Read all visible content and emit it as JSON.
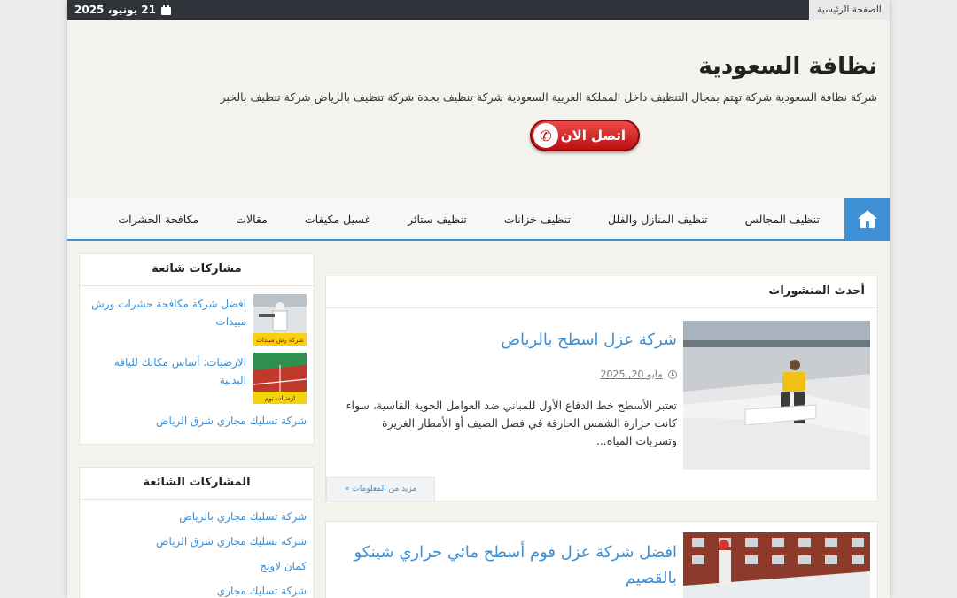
{
  "topbar": {
    "home_label": "الصفحة الرئيسية",
    "date": "21 يونيو، 2025"
  },
  "header": {
    "site_title": "نظافة السعودية",
    "site_description": "شركة نظافة السعودية شركة تهتم بمجال التنظيف داخل المملكة العربية السعودية شركة تنظيف بجدة شركة تنظيف بالرياض شركة تنظيف بالخبر",
    "call_button": "اتصل الان"
  },
  "nav": {
    "items": [
      {
        "label": "تنظيف المجالس"
      },
      {
        "label": "تنظيف المنازل والفلل"
      },
      {
        "label": "تنظيف خزانات"
      },
      {
        "label": "تنظيف ستائر"
      },
      {
        "label": "غسيل مكيفات"
      },
      {
        "label": "مقالات"
      },
      {
        "label": "مكافحة الحشرات"
      }
    ]
  },
  "main": {
    "section_title": "أحدث المنشورات",
    "posts": [
      {
        "title": "شركة عزل اسطح بالرياض",
        "date": "مايو 20, 2025",
        "excerpt": "تعتبر الأسطح خط الدفاع الأول للمباني ضد العوامل الجوية القاسية، سواء كانت حرارة الشمس الحارقة في فصل الصيف أو الأمطار الغزيرة وتسربات المياه...",
        "read_more": "مزيد من المعلومات »"
      },
      {
        "title": "افضل شركة عزل فوم أسطح مائي حراري شينكو بالقصيم"
      }
    ]
  },
  "sidebar": {
    "popular_title": "مشاركات شائعة",
    "popular_posts": [
      {
        "title": "افضل شركة مكافحة حشرات ورش مبيدات",
        "thumb_caption": "شركة رش مبيدات"
      },
      {
        "title": "الارضيات: أساس مكانك للياقة البدنية",
        "thumb_caption": "ارضيات نوم"
      },
      {
        "title": "شركة تسليك مجاري شرق الرياض"
      }
    ],
    "popular2_title": "المشاركات الشائعة",
    "popular2_posts": [
      {
        "title": "شركة تسليك مجاري بالرياض"
      },
      {
        "title": "شركة تسليك مجاري شرق الرياض"
      },
      {
        "title": "كمان لاونج"
      },
      {
        "title": "شركة تسليك مجاري"
      }
    ]
  },
  "colors": {
    "accent": "#3e8fd3",
    "topbar": "#30343a",
    "call_button": "#c01313",
    "page_background": "#f4f3ee"
  }
}
